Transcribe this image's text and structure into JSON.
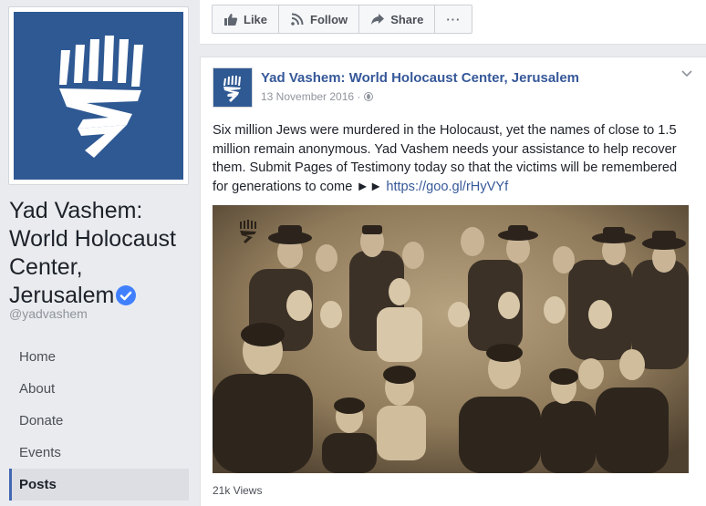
{
  "page": {
    "name": "Yad Vashem: World Holocaust Center, Jerusalem",
    "name_lines": [
      "Yad Vashem:",
      "World Holocaust",
      "Center,",
      "Jerusalem"
    ],
    "handle": "@yadvashem",
    "verified": true,
    "brand_color": "#2f5993"
  },
  "nav": {
    "items": [
      {
        "label": "Home",
        "active": false
      },
      {
        "label": "About",
        "active": false
      },
      {
        "label": "Donate",
        "active": false
      },
      {
        "label": "Events",
        "active": false
      },
      {
        "label": "Posts",
        "active": true
      }
    ]
  },
  "action_bar": {
    "like_label": "Like",
    "follow_label": "Follow",
    "share_label": "Share",
    "more_label": "···"
  },
  "post": {
    "author": "Yad Vashem: World Holocaust Center, Jerusalem",
    "date": "13 November 2016 ·",
    "audience_icon": "globe-icon",
    "text": "Six million Jews were murdered in the Holocaust, yet the names of close to 1.5 million remain anonymous. Yad Vashem needs your assistance to help recover them. Submit Pages of Testimony today so that the victims will be remembered for generations to come ►► ",
    "link": "https://goo.gl/rHyVYf",
    "views": "21k Views"
  },
  "colors": {
    "link": "#365899",
    "background": "#e9ebee",
    "photo_sepia": "#8a7558"
  }
}
